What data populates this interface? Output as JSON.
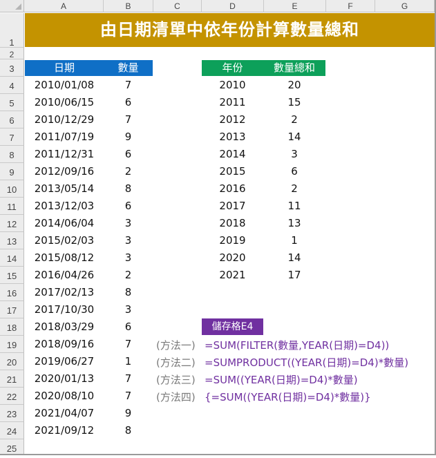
{
  "spreadsheet": {
    "columns": [
      "A",
      "B",
      "C",
      "D",
      "E",
      "F",
      "G"
    ],
    "rows": [
      "1",
      "2",
      "3",
      "4",
      "5",
      "6",
      "7",
      "8",
      "9",
      "10",
      "11",
      "12",
      "13",
      "14",
      "15",
      "16",
      "17",
      "18",
      "19",
      "20",
      "21",
      "22",
      "23",
      "24",
      "25"
    ]
  },
  "title": "由日期清單中依年份計算數量總和",
  "left_table": {
    "header_date": "日期",
    "header_qty": "數量",
    "rows": [
      {
        "date": "2010/01/08",
        "qty": "7"
      },
      {
        "date": "2010/06/15",
        "qty": "6"
      },
      {
        "date": "2010/12/29",
        "qty": "7"
      },
      {
        "date": "2011/07/19",
        "qty": "9"
      },
      {
        "date": "2011/12/31",
        "qty": "6"
      },
      {
        "date": "2012/09/16",
        "qty": "2"
      },
      {
        "date": "2013/05/14",
        "qty": "8"
      },
      {
        "date": "2013/12/03",
        "qty": "6"
      },
      {
        "date": "2014/06/04",
        "qty": "3"
      },
      {
        "date": "2015/02/03",
        "qty": "3"
      },
      {
        "date": "2015/08/12",
        "qty": "3"
      },
      {
        "date": "2016/04/26",
        "qty": "2"
      },
      {
        "date": "2017/02/13",
        "qty": "8"
      },
      {
        "date": "2017/10/30",
        "qty": "3"
      },
      {
        "date": "2018/03/29",
        "qty": "6"
      },
      {
        "date": "2018/09/16",
        "qty": "7"
      },
      {
        "date": "2019/06/27",
        "qty": "1"
      },
      {
        "date": "2020/01/13",
        "qty": "7"
      },
      {
        "date": "2020/08/10",
        "qty": "7"
      },
      {
        "date": "2021/04/07",
        "qty": "9"
      },
      {
        "date": "2021/09/12",
        "qty": "8"
      }
    ]
  },
  "right_table": {
    "header_year": "年份",
    "header_sum": "數量總和",
    "rows": [
      {
        "year": "2010",
        "sum": "20"
      },
      {
        "year": "2011",
        "sum": "15"
      },
      {
        "year": "2012",
        "sum": "2"
      },
      {
        "year": "2013",
        "sum": "14"
      },
      {
        "year": "2014",
        "sum": "3"
      },
      {
        "year": "2015",
        "sum": "6"
      },
      {
        "year": "2016",
        "sum": "2"
      },
      {
        "year": "2017",
        "sum": "11"
      },
      {
        "year": "2018",
        "sum": "13"
      },
      {
        "year": "2019",
        "sum": "1"
      },
      {
        "year": "2020",
        "sum": "14"
      },
      {
        "year": "2021",
        "sum": "17"
      }
    ]
  },
  "cell_label": "儲存格E4",
  "methods": [
    {
      "name": "(方法一)",
      "formula": "=SUM(FILTER(數量,YEAR(日期)=D4))"
    },
    {
      "name": "(方法二)",
      "formula": "=SUMPRODUCT((YEAR(日期)=D4)*數量)"
    },
    {
      "name": "(方法三)",
      "formula": "=SUM((YEAR(日期)=D4)*數量)"
    },
    {
      "name": "(方法四)",
      "formula": "{=SUM((YEAR(日期)=D4)*數量)}"
    }
  ],
  "colors": {
    "title_bg": "#c49300",
    "date_header_bg": "#0f6fc6",
    "year_header_bg": "#0da05a",
    "badge_bg": "#7030a0",
    "formula_text": "#7030a0",
    "method_text": "#7a7a7a"
  },
  "icons": {
    "select_all": "select-all-triangle-icon"
  }
}
